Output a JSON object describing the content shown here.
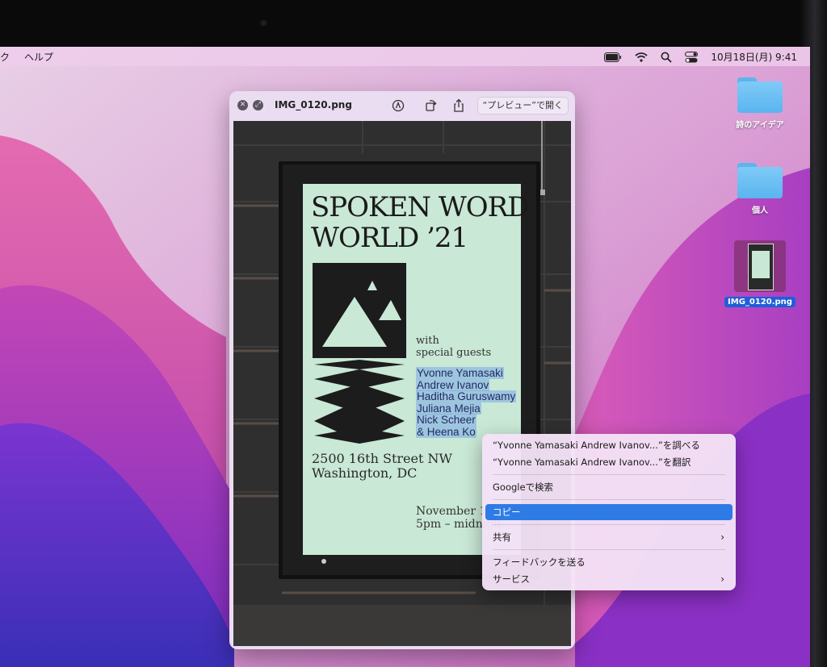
{
  "menubar": {
    "left_items": [
      "ク",
      "ヘルプ"
    ],
    "clock": "10月18日(月)  9:41",
    "icons": [
      "battery-icon",
      "wifi-icon",
      "search-icon",
      "control-center-icon"
    ]
  },
  "desktop": {
    "items": [
      {
        "label": "詩のアイデア",
        "icon": "folder-icon"
      },
      {
        "label": "個人",
        "icon": "folder-icon"
      },
      {
        "label": "IMG_0120.png",
        "icon": "image-thumbnail",
        "selected": true
      }
    ]
  },
  "quicklook": {
    "title": "IMG_0120.png",
    "open_button": "“プレビュー”で開く",
    "icons": [
      "close-icon",
      "fullscreen-icon",
      "markup-icon",
      "rotate-icon",
      "share-icon"
    ]
  },
  "poster": {
    "title_line1": "SPOKEN WORD",
    "title_line2": "WORLD ’21",
    "with_line1": "with",
    "with_line2": "special guests",
    "guests": [
      "Yvonne Yamasaki",
      "Andrew Ivanov",
      "Haditha Guruswamy",
      "Juliana Mejia",
      "Nick Scheer",
      "& Heena Ko"
    ],
    "address_line1": "2500 16th Street NW",
    "address_line2": "Washington, DC",
    "date_line1": "November 10,",
    "date_line2": "5pm – midnigh"
  },
  "context_menu": {
    "items": [
      {
        "label": "“Yvonne Yamasaki Andrew Ivanov...”を調べる"
      },
      {
        "label": "“Yvonne Yamasaki Andrew Ivanov...”を翻訳"
      },
      {
        "label": "Googleで検索"
      },
      {
        "label": "コピー",
        "active": true
      },
      {
        "label": "共有",
        "submenu": true
      },
      {
        "label": "フィードバックを送る"
      },
      {
        "label": "サービス",
        "submenu": true
      }
    ]
  },
  "colors": {
    "accent": "#2f7be6",
    "selection": "#1f5fd8",
    "folder": "#5ab5ef"
  }
}
